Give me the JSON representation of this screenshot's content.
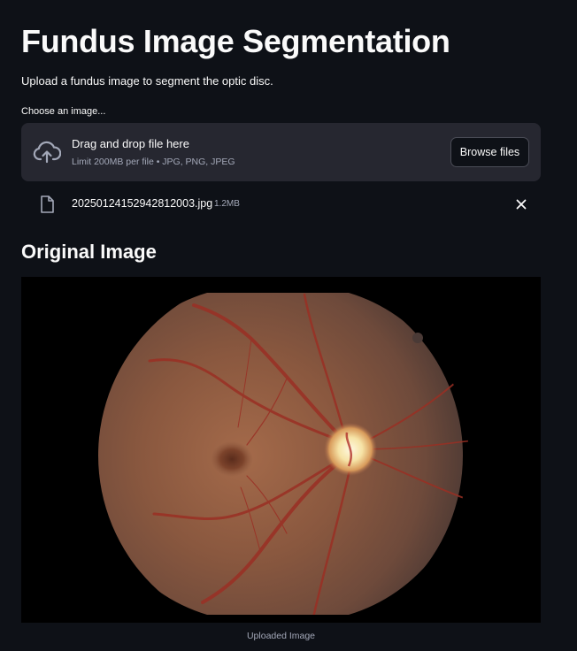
{
  "header": {
    "title": "Fundus Image Segmentation",
    "subtitle": "Upload a fundus image to segment the optic disc."
  },
  "uploader": {
    "label": "Choose an image...",
    "dropzone_title": "Drag and drop file here",
    "dropzone_limit": "Limit 200MB per file • JPG, PNG, JPEG",
    "browse_label": "Browse files",
    "icon": "cloud-upload-icon"
  },
  "uploaded_file": {
    "name": "20250124152942812003.jpg",
    "size": "1.2MB",
    "icon": "file-icon",
    "remove_icon": "close-icon"
  },
  "original_section": {
    "heading": "Original Image",
    "caption": "Uploaded Image"
  },
  "colors": {
    "background": "#0e1117",
    "surface": "#262730",
    "text": "#fafafa",
    "muted_text": "#a3a8b8"
  }
}
